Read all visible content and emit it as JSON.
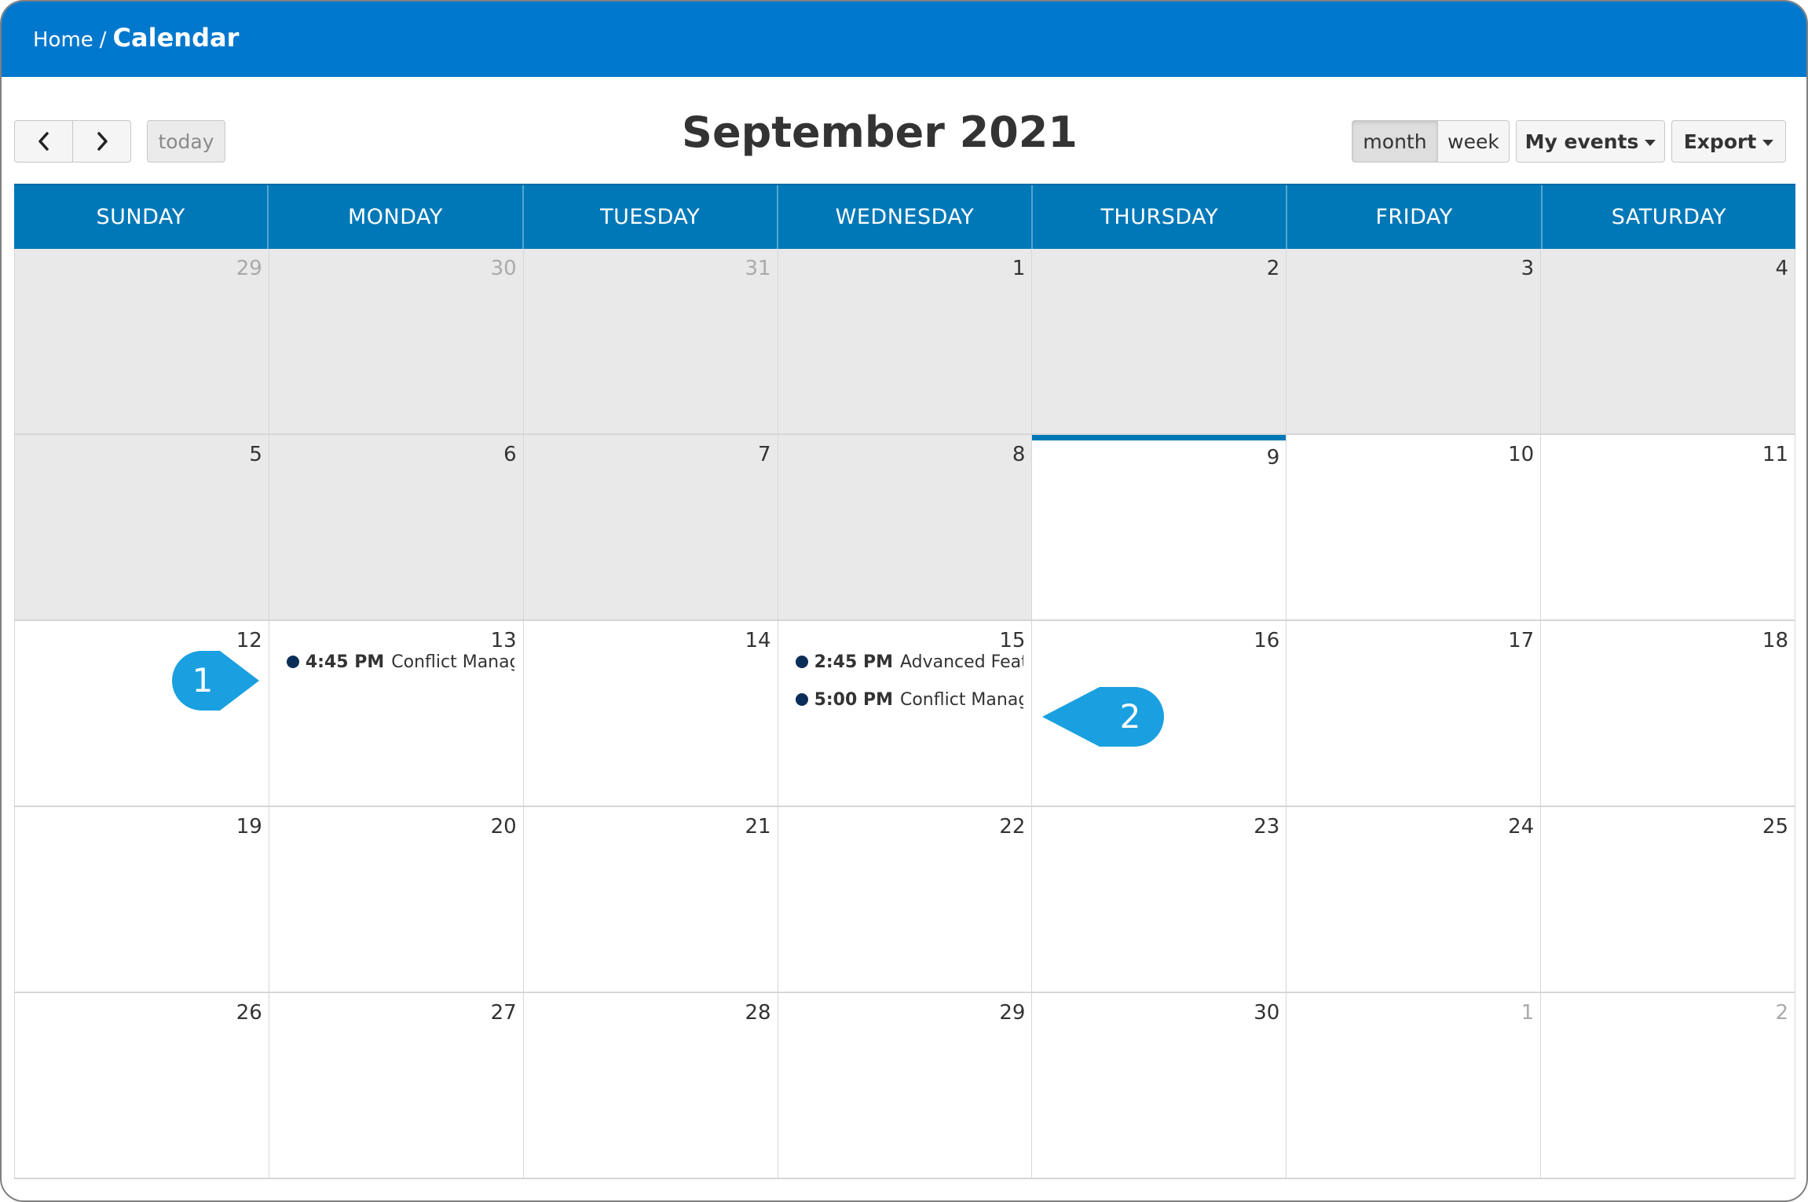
{
  "header": {
    "breadcrumb_home": "Home",
    "breadcrumb_sep": "/",
    "breadcrumb_current": "Calendar",
    "bg_color": "#0078cd"
  },
  "toolbar": {
    "prev_icon": "chevron-left-icon",
    "next_icon": "chevron-right-icon",
    "today_label": "today",
    "title": "September 2021",
    "month_label": "month",
    "week_label": "week",
    "my_events_label": "My events",
    "export_label": "Export"
  },
  "weekdays": [
    "SUNDAY",
    "MONDAY",
    "TUESDAY",
    "WEDNESDAY",
    "THURSDAY",
    "FRIDAY",
    "SATURDAY"
  ],
  "weeks": [
    {
      "days": [
        {
          "num": "29",
          "status": "other-past"
        },
        {
          "num": "30",
          "status": "other-past"
        },
        {
          "num": "31",
          "status": "other-past"
        },
        {
          "num": "1",
          "status": "past"
        },
        {
          "num": "2",
          "status": "past"
        },
        {
          "num": "3",
          "status": "past"
        },
        {
          "num": "4",
          "status": "past"
        }
      ]
    },
    {
      "days": [
        {
          "num": "5",
          "status": "past"
        },
        {
          "num": "6",
          "status": "past"
        },
        {
          "num": "7",
          "status": "past"
        },
        {
          "num": "8",
          "status": "past"
        },
        {
          "num": "9",
          "status": "today"
        },
        {
          "num": "10",
          "status": "future"
        },
        {
          "num": "11",
          "status": "future"
        }
      ]
    },
    {
      "days": [
        {
          "num": "12",
          "status": "future"
        },
        {
          "num": "13",
          "status": "future",
          "events": [
            {
              "time": "4:45 PM",
              "title": "Conflict Management"
            }
          ]
        },
        {
          "num": "14",
          "status": "future"
        },
        {
          "num": "15",
          "status": "future",
          "events": [
            {
              "time": "2:45 PM",
              "title": "Advanced Features"
            },
            {
              "time": "5:00 PM",
              "title": "Conflict Management"
            }
          ]
        },
        {
          "num": "16",
          "status": "future"
        },
        {
          "num": "17",
          "status": "future"
        },
        {
          "num": "18",
          "status": "future"
        }
      ]
    },
    {
      "days": [
        {
          "num": "19",
          "status": "future"
        },
        {
          "num": "20",
          "status": "future"
        },
        {
          "num": "21",
          "status": "future"
        },
        {
          "num": "22",
          "status": "future"
        },
        {
          "num": "23",
          "status": "future"
        },
        {
          "num": "24",
          "status": "future"
        },
        {
          "num": "25",
          "status": "future"
        }
      ]
    },
    {
      "days": [
        {
          "num": "26",
          "status": "future"
        },
        {
          "num": "27",
          "status": "future"
        },
        {
          "num": "28",
          "status": "future"
        },
        {
          "num": "29",
          "status": "future"
        },
        {
          "num": "30",
          "status": "future"
        },
        {
          "num": "1",
          "status": "other-future"
        },
        {
          "num": "2",
          "status": "other-future"
        }
      ]
    }
  ],
  "callouts": [
    {
      "label": "1",
      "icon": "callout-marker-icon"
    },
    {
      "label": "2",
      "icon": "callout-marker-icon"
    }
  ],
  "colors": {
    "accent": "#0078b8",
    "past_bg": "#e9e9e9",
    "event_dot": "#0b2e59",
    "callout": "#1aa0e0"
  }
}
